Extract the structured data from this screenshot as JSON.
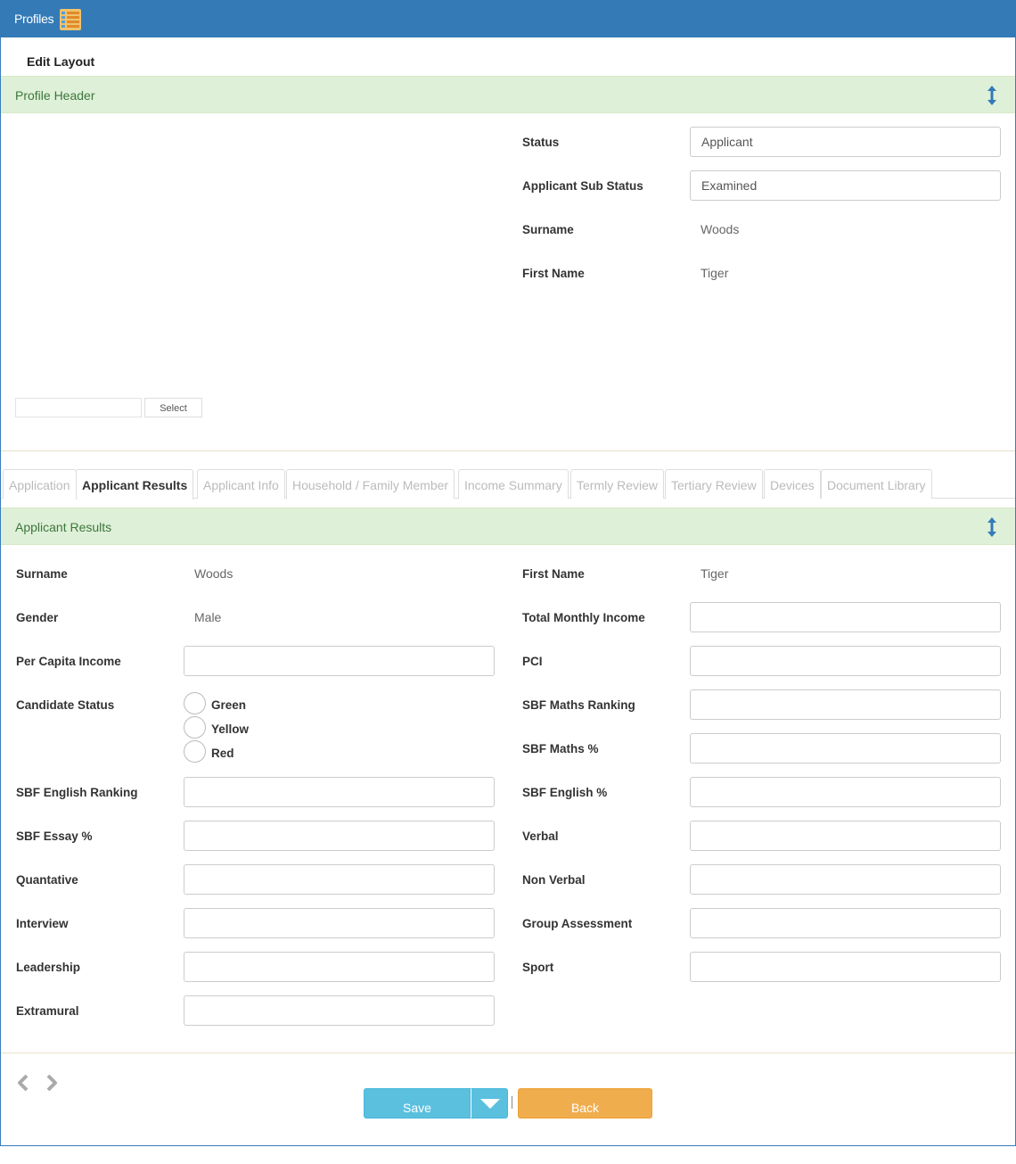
{
  "window": {
    "title": "Profiles"
  },
  "toolbar": {
    "edit_layout": "Edit Layout"
  },
  "profile_header": {
    "title": "Profile Header",
    "status_label": "Status",
    "status_value": "Applicant",
    "sub_status_label": "Applicant Sub Status",
    "sub_status_value": "Examined",
    "surname_label": "Surname",
    "surname_value": "Woods",
    "firstname_label": "First Name",
    "firstname_value": "Tiger",
    "select_label": "Select"
  },
  "tabs": [
    {
      "label": "Application",
      "active": false
    },
    {
      "label": "Applicant Results",
      "active": true
    },
    {
      "label": "Applicant Info",
      "active": false
    },
    {
      "label": "Household / Family Member",
      "active": false
    },
    {
      "label": "Income Summary",
      "active": false
    },
    {
      "label": "Termly Review",
      "active": false
    },
    {
      "label": "Tertiary Review",
      "active": false
    },
    {
      "label": "Devices",
      "active": false
    },
    {
      "label": "Document Library",
      "active": false
    }
  ],
  "results": {
    "title": "Applicant Results",
    "surname_label": "Surname",
    "surname_value": "Woods",
    "firstname_label": "First Name",
    "firstname_value": "Tiger",
    "gender_label": "Gender",
    "gender_value": "Male",
    "total_monthly_income_label": "Total Monthly Income",
    "per_capita_income_label": "Per Capita Income",
    "pci_label": "PCI",
    "candidate_status_label": "Candidate Status",
    "candidate_status_options": [
      "Green",
      "Yellow",
      "Red"
    ],
    "sbf_maths_ranking_label": "SBF Maths Ranking",
    "sbf_maths_pct_label": "SBF Maths %",
    "sbf_english_ranking_label": "SBF English Ranking",
    "sbf_english_pct_label": "SBF English %",
    "sbf_essay_pct_label": "SBF Essay %",
    "verbal_label": "Verbal",
    "quantative_label": "Quantative",
    "non_verbal_label": "Non Verbal",
    "interview_label": "Interview",
    "group_assessment_label": "Group Assessment",
    "leadership_label": "Leadership",
    "sport_label": "Sport",
    "extramural_label": "Extramural"
  },
  "footer": {
    "save_label": "Save",
    "back_label": "Back"
  },
  "colors": {
    "header_blue": "#337ab7",
    "section_green": "#dff0d8",
    "save": "#5bc0de",
    "back": "#f0ad4e"
  }
}
